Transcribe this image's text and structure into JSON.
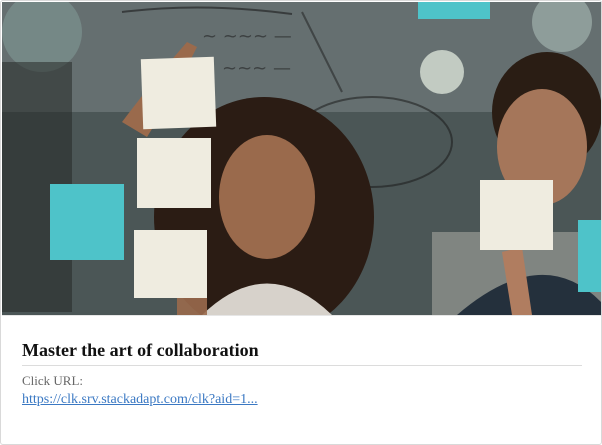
{
  "ad": {
    "image_alt": "Two people placing sticky notes on a glass wall",
    "title": "Master the art of collaboration",
    "click_label": "Click URL:",
    "click_url": "https://clk.srv.stackadapt.com/clk?aid=1..."
  },
  "colors": {
    "title": "#111111",
    "label": "#666666",
    "link": "#3a78c3",
    "sticky_note_white": "#efece0",
    "sticky_note_teal": "#4ec3c9"
  }
}
